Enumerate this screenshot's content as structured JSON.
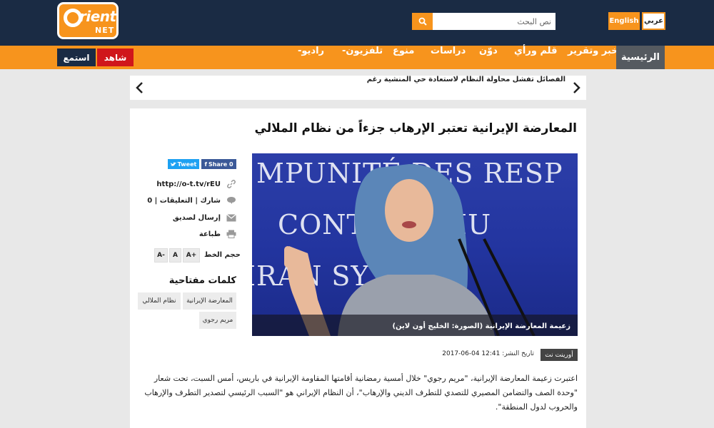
{
  "header": {
    "logo": {
      "text_main": "rient",
      "text_sub": "NET",
      "brand_color": "#f7941d",
      "icon": "orient-logo"
    },
    "search": {
      "placeholder": "نص البحث",
      "icon": "search-icon"
    },
    "languages": {
      "english": "English",
      "arabic": "عربي"
    },
    "colors": {
      "dark": "#1a2b44",
      "orange": "#f7941d",
      "red": "#d0161b",
      "home_gray": "#555a60"
    }
  },
  "nav": {
    "home": "الرئيسية",
    "items": [
      "خبر وتقرير",
      "قلم ورأي",
      "دوّن",
      "دراسات",
      "منوع",
      "تلفزيون-",
      "راديو-"
    ],
    "watch": "شاهد",
    "listen": "استمع"
  },
  "ticker": {
    "text": "الفصائل تفشل محاولة النظام لاستعادة حي المنشية رغم عشرات الغارات الجوية"
  },
  "article": {
    "title": "المعارضة الإيرانية تعتبر الإرهاب جزءاً من نظام الملالي",
    "photo_caption": "زعيمة المعارضة الإيرانية (الصورة: الخليج أون لاين)",
    "source": "أورينت نت",
    "date_label": "تاريخ النشر:",
    "date_value": "2017-06-04 12:41",
    "body": "اعتبرت زعيمة المعارضة الإيرانية، \"مريم رجوي\" خلال أمسية رمضانية أقامتها المقاومة الإيرانية في باريس، أمس السبت، تحت شعار \"وحدة الصف والتضامن المصيري للتصدي للتطرف الديني والإرهاب\"، أن النظام الإيراني هو \"السبب الرئيسي لتصدير التطرف والإرهاب والحروب لدول المنطقة\"."
  },
  "sidebar": {
    "share_facebook": "Share 0",
    "share_twitter": "Tweet",
    "short_link": "http://o-t.tv/rEU",
    "comments": "شارك | التعليقات | 0",
    "send_friend": "إرسال لصديق",
    "print": "طباعة",
    "font_size_label": "حجم الخط",
    "font_buttons": [
      "A+",
      "A",
      "A-"
    ],
    "keywords_title": "كلمات مفتاحية",
    "keywords": [
      "المعارضة الإيرانية",
      "نظام الملالي",
      "مريم رجوي"
    ]
  }
}
